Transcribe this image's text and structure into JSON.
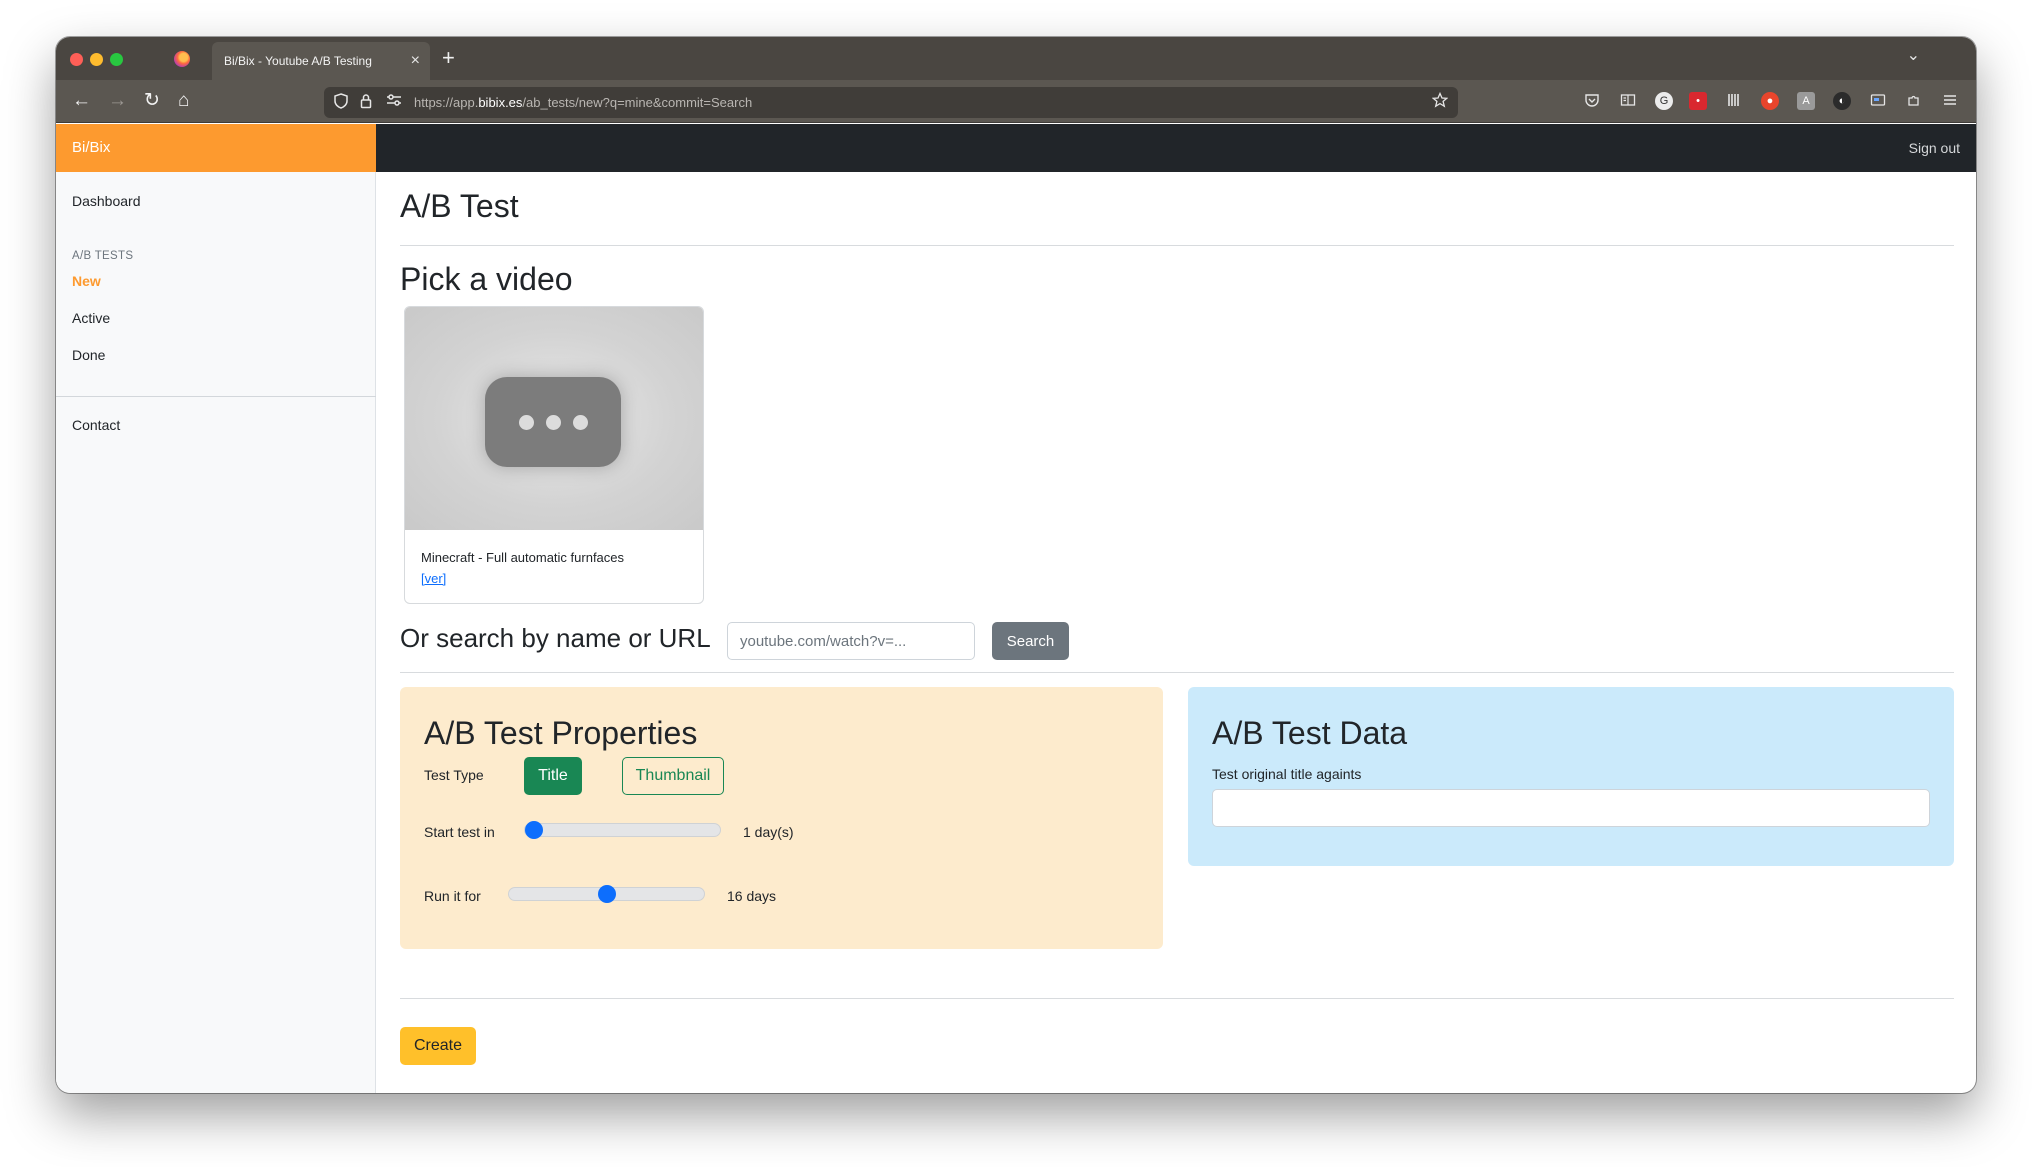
{
  "browser": {
    "tab_title": "Bi/Bix - Youtube A/B Testing",
    "tab_close": "×",
    "new_tab": "+",
    "tab_list": "⌄",
    "url_prefix": "https://app.",
    "url_host": "bibix.es",
    "url_path": "/ab_tests/new?q=mine&commit=Search",
    "nav": {
      "back": "←",
      "forward": "→",
      "reload": "↻",
      "home": "⌂"
    }
  },
  "app": {
    "brand": "Bi/Bix",
    "sign_out": "Sign out",
    "brand_color": "#fd9a2f"
  },
  "sidebar": {
    "dashboard": "Dashboard",
    "section_heading": "A/B TESTS",
    "items": [
      {
        "label": "New",
        "active": true
      },
      {
        "label": "Active",
        "active": false
      },
      {
        "label": "Done",
        "active": false
      }
    ],
    "contact": "Contact"
  },
  "main": {
    "page_title": "A/B Test",
    "pick_title": "Pick a video",
    "video": {
      "title": "Minecraft - Full automatic furnfaces",
      "link": "[ver]"
    },
    "search": {
      "label": "Or search by name or URL",
      "placeholder": "youtube.com/watch?v=...",
      "button": "Search"
    },
    "properties": {
      "title": "A/B Test Properties",
      "test_type_label": "Test Type",
      "type_options": [
        "Title",
        "Thumbnail"
      ],
      "selected_type": "Title",
      "start_label": "Start test in",
      "start_value": 1,
      "start_value_text": "1 day(s)",
      "run_label": "Run it for",
      "run_value": 16,
      "run_value_text": "16 days",
      "run_slider_fraction": 0.5
    },
    "data": {
      "title": "A/B Test Data",
      "field_label": "Test original title againts",
      "field_value": ""
    },
    "create_button": "Create"
  }
}
